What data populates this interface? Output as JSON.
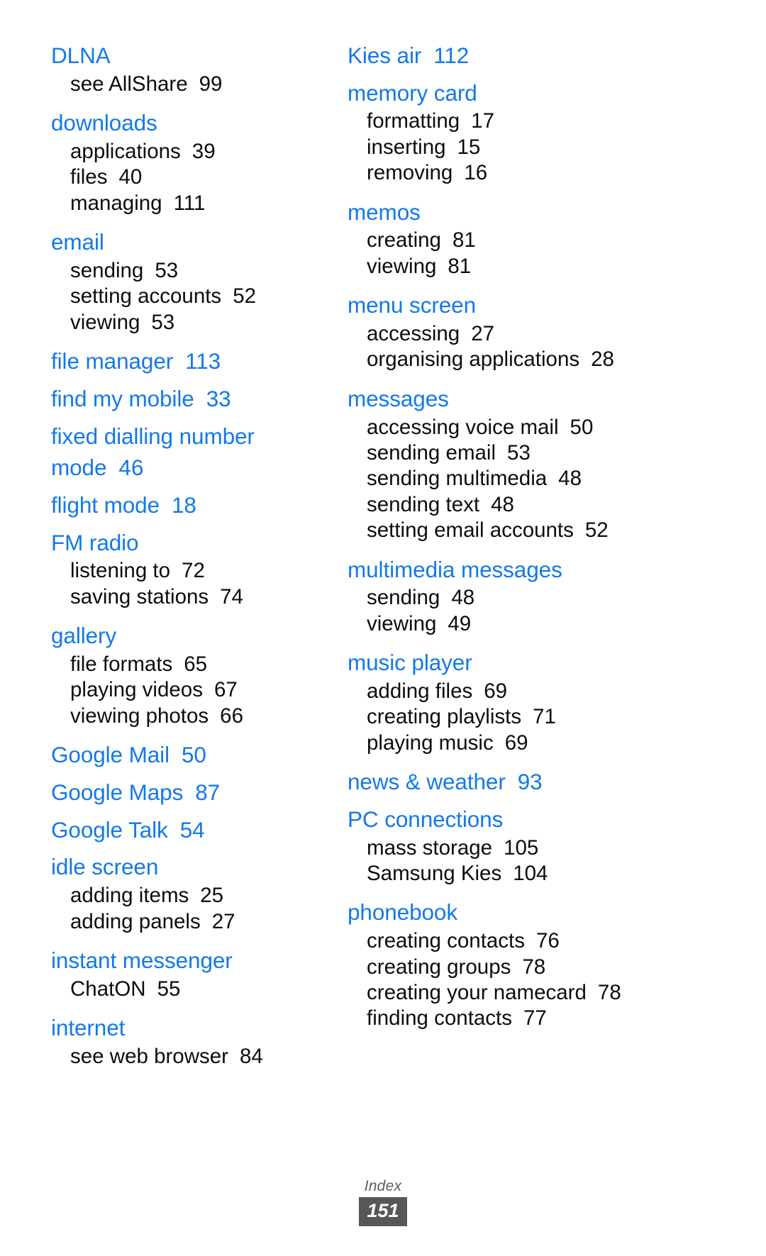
{
  "document": {
    "footer_label": "Index",
    "page_number": "151",
    "heading_color": "#1379e8",
    "body_color": "#0d0d0d",
    "badge_color": "#575757"
  },
  "columns": [
    {
      "id": "left",
      "groups": [
        {
          "head": "DLNA",
          "head_page": "",
          "subs": [
            {
              "label": "see AllShare",
              "page": "99"
            }
          ]
        },
        {
          "head": "downloads",
          "head_page": "",
          "subs": [
            {
              "label": "applications",
              "page": "39"
            },
            {
              "label": "files",
              "page": "40"
            },
            {
              "label": "managing",
              "page": "111"
            }
          ]
        },
        {
          "head": "email",
          "head_page": "",
          "subs": [
            {
              "label": "sending",
              "page": "53"
            },
            {
              "label": "setting accounts",
              "page": "52"
            },
            {
              "label": "viewing",
              "page": "53"
            }
          ]
        },
        {
          "head": "file manager",
          "head_page": "113",
          "subs": []
        },
        {
          "head": "find my mobile",
          "head_page": "33",
          "subs": []
        },
        {
          "head": "fixed dialling number mode",
          "head_page": "46",
          "subs": []
        },
        {
          "head": "flight mode",
          "head_page": "18",
          "subs": []
        },
        {
          "head": "FM radio",
          "head_page": "",
          "subs": [
            {
              "label": "listening to",
              "page": "72"
            },
            {
              "label": "saving stations",
              "page": "74"
            }
          ]
        },
        {
          "head": "gallery",
          "head_page": "",
          "subs": [
            {
              "label": "file formats",
              "page": "65"
            },
            {
              "label": "playing videos",
              "page": "67"
            },
            {
              "label": "viewing photos",
              "page": "66"
            }
          ]
        },
        {
          "head": "Google Mail",
          "head_page": "50",
          "subs": []
        },
        {
          "head": "Google Maps",
          "head_page": "87",
          "subs": []
        },
        {
          "head": "Google Talk",
          "head_page": "54",
          "subs": []
        },
        {
          "head": "idle screen",
          "head_page": "",
          "subs": [
            {
              "label": "adding items",
              "page": "25"
            },
            {
              "label": "adding panels",
              "page": "27"
            }
          ]
        },
        {
          "head": "instant messenger",
          "head_page": "",
          "subs": [
            {
              "label": "ChatON",
              "page": "55"
            }
          ]
        },
        {
          "head": "internet",
          "head_page": "",
          "subs": [
            {
              "label": "see web browser",
              "page": "84"
            }
          ]
        }
      ]
    },
    {
      "id": "right",
      "groups": [
        {
          "head": "Kies air",
          "head_page": "112",
          "subs": []
        },
        {
          "head": "memory card",
          "head_page": "",
          "subs": [
            {
              "label": "formatting",
              "page": "17"
            },
            {
              "label": "inserting",
              "page": "15"
            },
            {
              "label": "removing",
              "page": "16"
            }
          ]
        },
        {
          "head": "memos",
          "head_page": "",
          "subs": [
            {
              "label": "creating",
              "page": "81"
            },
            {
              "label": "viewing",
              "page": "81"
            }
          ]
        },
        {
          "head": "menu screen",
          "head_page": "",
          "subs": [
            {
              "label": "accessing",
              "page": "27"
            },
            {
              "label": "organising applications",
              "page": "28"
            }
          ]
        },
        {
          "head": "messages",
          "head_page": "",
          "subs": [
            {
              "label": "accessing voice mail",
              "page": "50"
            },
            {
              "label": "sending email",
              "page": "53"
            },
            {
              "label": "sending multimedia",
              "page": "48"
            },
            {
              "label": "sending text",
              "page": "48"
            },
            {
              "label": "setting email accounts",
              "page": "52"
            }
          ]
        },
        {
          "head": "multimedia messages",
          "head_page": "",
          "subs": [
            {
              "label": "sending",
              "page": "48"
            },
            {
              "label": "viewing",
              "page": "49"
            }
          ]
        },
        {
          "head": "music player",
          "head_page": "",
          "subs": [
            {
              "label": "adding files",
              "page": "69"
            },
            {
              "label": "creating playlists",
              "page": "71"
            },
            {
              "label": "playing music",
              "page": "69"
            }
          ]
        },
        {
          "head": "news & weather",
          "head_page": "93",
          "subs": []
        },
        {
          "head": "PC connections",
          "head_page": "",
          "subs": [
            {
              "label": "mass storage",
              "page": "105"
            },
            {
              "label": "Samsung Kies",
              "page": "104"
            }
          ]
        },
        {
          "head": "phonebook",
          "head_page": "",
          "subs": [
            {
              "label": "creating contacts",
              "page": "76"
            },
            {
              "label": "creating groups",
              "page": "78"
            },
            {
              "label": "creating your namecard",
              "page": "78"
            },
            {
              "label": "finding contacts",
              "page": "77"
            }
          ]
        }
      ]
    }
  ]
}
